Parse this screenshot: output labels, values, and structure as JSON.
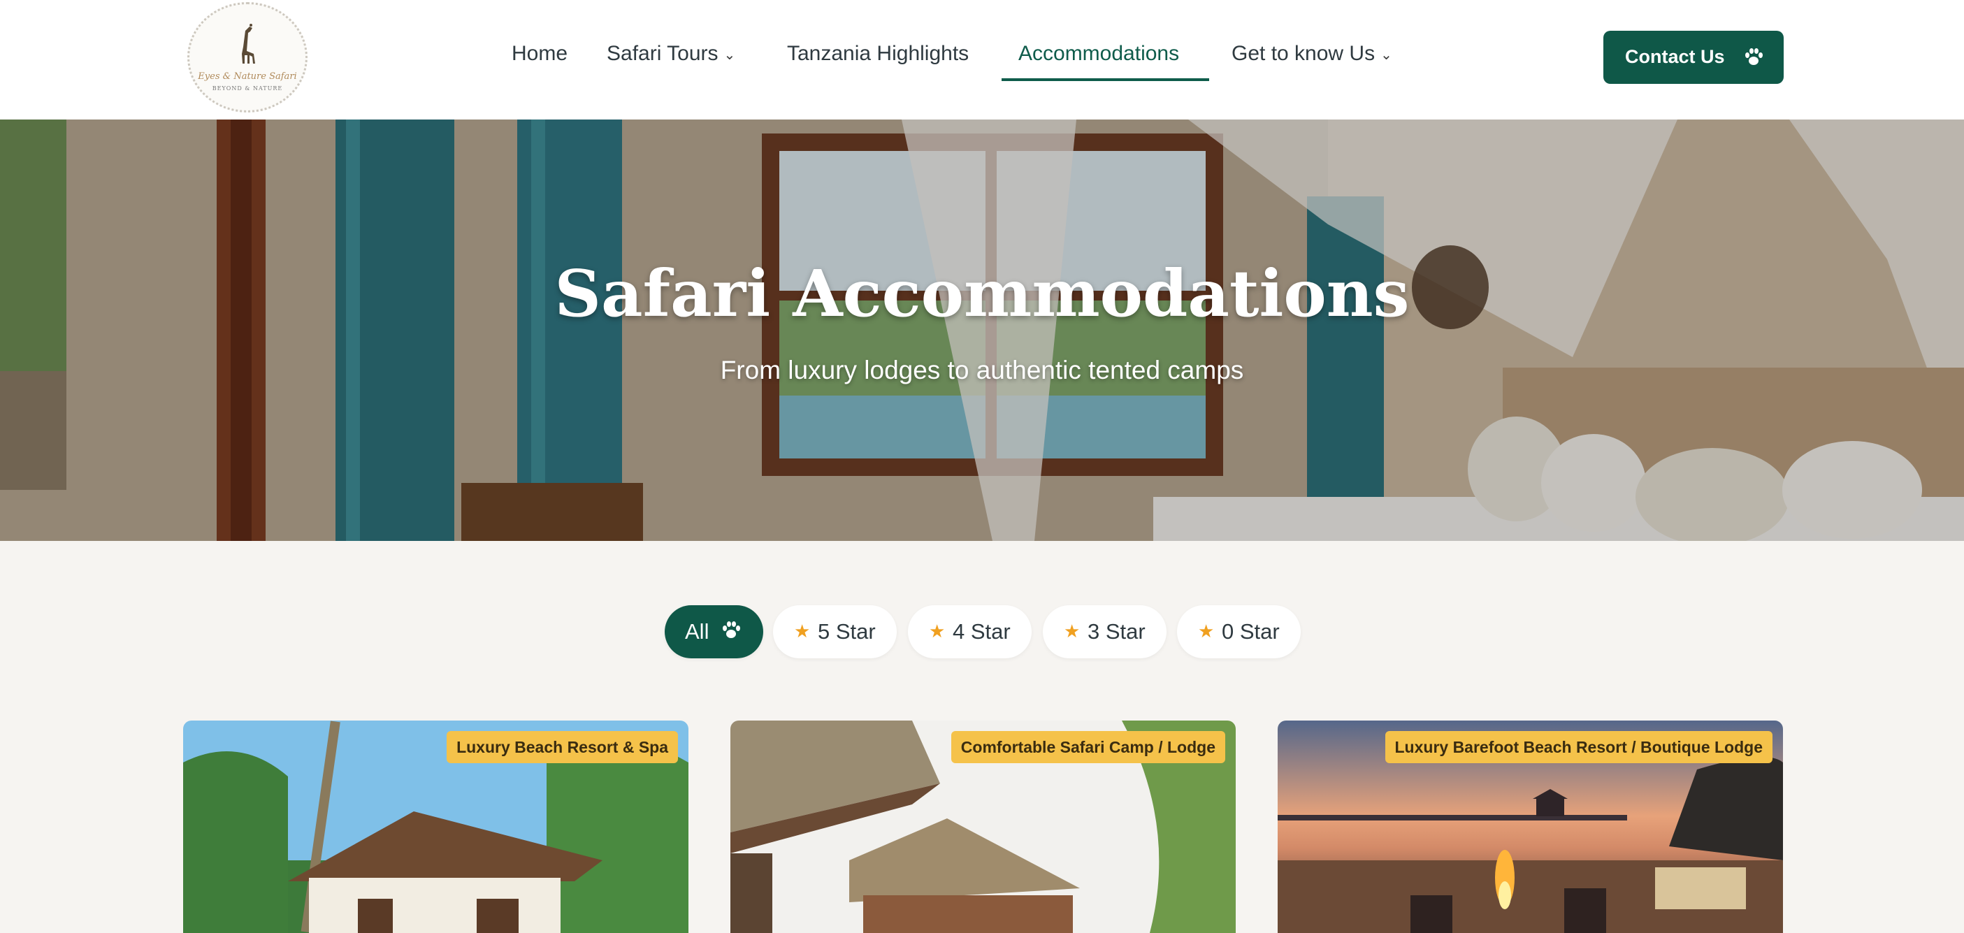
{
  "logo": {
    "line1": "Eyes & Nature Safari",
    "line2": "BEYOND & NATURE"
  },
  "nav": {
    "items": [
      {
        "label": "Home"
      },
      {
        "label": "Safari Tours",
        "chevron": "chevron-down-icon"
      },
      {
        "label": "Tanzania Highlights"
      },
      {
        "label": "Accommodations",
        "active": true
      },
      {
        "label": "Get to know Us",
        "chevron": "chevron-down-icon"
      }
    ],
    "contact_label": "Contact Us",
    "contact_icon": "paw-icon"
  },
  "hero": {
    "title": "Safari Accommodations",
    "subtitle": "From luxury lodges to authentic tented camps"
  },
  "filters": [
    {
      "label": "All",
      "icon": "paw-icon",
      "active": true
    },
    {
      "label": "5 Star",
      "icon": "star-icon"
    },
    {
      "label": "4 Star",
      "icon": "star-icon"
    },
    {
      "label": "3 Star",
      "icon": "star-icon"
    },
    {
      "label": "0 Star",
      "icon": "star-icon"
    }
  ],
  "cards": [
    {
      "badge": "Luxury Beach Resort & Spa"
    },
    {
      "badge": "Comfortable Safari Camp / Lodge"
    },
    {
      "badge": "Luxury Barefoot Beach Resort / Boutique Lodge"
    }
  ],
  "colors": {
    "brand_green": "#0f5848",
    "badge_yellow": "#f5c24a",
    "star": "#f0a020",
    "page_bg": "#f6f4f1"
  }
}
